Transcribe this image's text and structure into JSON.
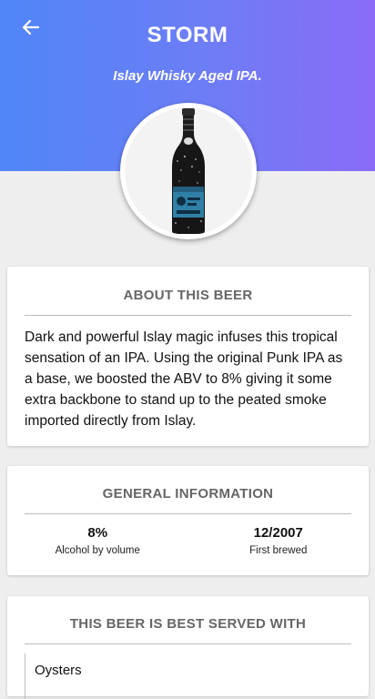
{
  "header": {
    "title": "STORM",
    "tagline": "Islay Whisky Aged IPA.",
    "gradient_start": "#4f86f7",
    "gradient_end": "#8a6cf6"
  },
  "back_icon": "arrow-left-icon",
  "about": {
    "heading": "ABOUT THIS BEER",
    "description": "Dark and powerful Islay magic infuses this tropical sensation of an IPA. Using the original Punk IPA as a base, we boosted the ABV to 8% giving it some extra backbone to stand up to the peated smoke imported directly from Islay."
  },
  "general": {
    "heading": "GENERAL INFORMATION",
    "abv_value": "8%",
    "abv_label": "Alcohol by volume",
    "first_brewed_value": "12/2007",
    "first_brewed_label": "First brewed"
  },
  "served_with": {
    "heading": "THIS BEER IS BEST SERVED WITH",
    "items": [
      "Oysters"
    ]
  }
}
